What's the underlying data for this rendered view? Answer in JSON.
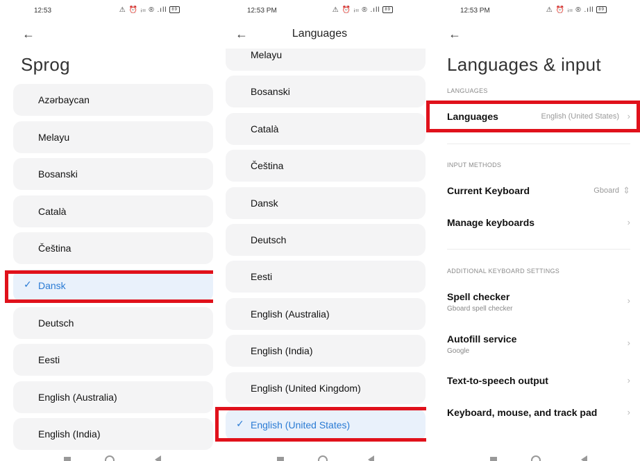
{
  "status": {
    "p1_time": "12:53",
    "p2_time": "12:53 PM",
    "p3_time": "12:53 PM",
    "right_icons": "⚠ ⏰ ᵢₗₗ ® .ıll",
    "battery": "89"
  },
  "panel1": {
    "title": "Sprog",
    "items": [
      {
        "label": "Azərbaycan",
        "selected": false
      },
      {
        "label": "Melayu",
        "selected": false
      },
      {
        "label": "Bosanski",
        "selected": false
      },
      {
        "label": "Català",
        "selected": false
      },
      {
        "label": "Čeština",
        "selected": false
      },
      {
        "label": "Dansk",
        "selected": true
      },
      {
        "label": "Deutsch",
        "selected": false
      },
      {
        "label": "Eesti",
        "selected": false
      },
      {
        "label": "English (Australia)",
        "selected": false
      },
      {
        "label": "English (India)",
        "selected": false
      }
    ]
  },
  "panel2": {
    "title": "Languages",
    "items": [
      {
        "label": "Melayu",
        "selected": false
      },
      {
        "label": "Bosanski",
        "selected": false
      },
      {
        "label": "Català",
        "selected": false
      },
      {
        "label": "Čeština",
        "selected": false
      },
      {
        "label": "Dansk",
        "selected": false
      },
      {
        "label": "Deutsch",
        "selected": false
      },
      {
        "label": "Eesti",
        "selected": false
      },
      {
        "label": "English (Australia)",
        "selected": false
      },
      {
        "label": "English (India)",
        "selected": false
      },
      {
        "label": "English (United Kingdom)",
        "selected": false
      },
      {
        "label": "English (United States)",
        "selected": true
      }
    ]
  },
  "panel3": {
    "title": "Languages & input",
    "sec_languages": "LANGUAGES",
    "languages_title": "Languages",
    "languages_value": "English (United States)",
    "sec_input": "INPUT METHODS",
    "keyboard_title": "Current Keyboard",
    "keyboard_value": "Gboard",
    "manage_title": "Manage keyboards",
    "sec_additional": "ADDITIONAL KEYBOARD SETTINGS",
    "spell_title": "Spell checker",
    "spell_sub": "Gboard spell checker",
    "autofill_title": "Autofill service",
    "autofill_sub": "Google",
    "tts_title": "Text-to-speech output",
    "kmt_title": "Keyboard, mouse, and track pad"
  },
  "colors": {
    "highlight": "#e0111b",
    "selected_text": "#2a7bd4",
    "card_bg": "#f4f4f5"
  }
}
